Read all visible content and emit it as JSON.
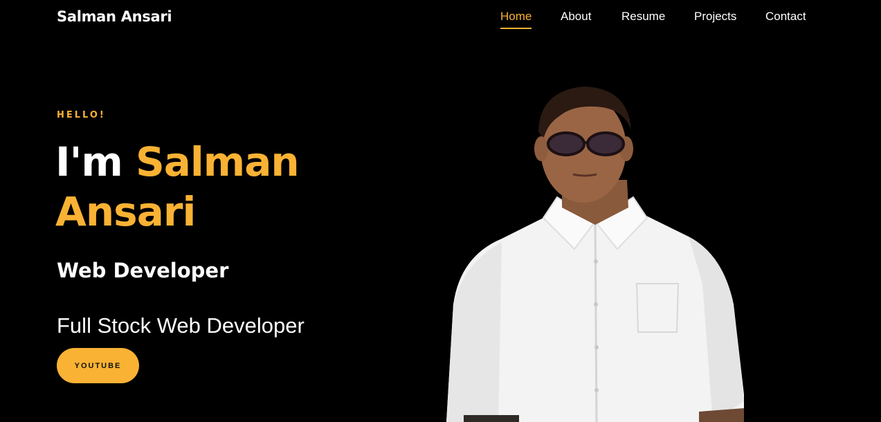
{
  "header": {
    "brand": "Salman Ansari",
    "nav": [
      {
        "label": "Home",
        "active": true
      },
      {
        "label": "About",
        "active": false
      },
      {
        "label": "Resume",
        "active": false
      },
      {
        "label": "Projects",
        "active": false
      },
      {
        "label": "Contact",
        "active": false
      }
    ]
  },
  "hero": {
    "greeting": "HELLO!",
    "headline_prefix": "I'm",
    "name_first": "Salman",
    "name_last": "Ansari",
    "role": "Web Developer",
    "tagline": "Full Stock Web Developer",
    "button_label": "YOUTUBE"
  },
  "colors": {
    "background": "#000000",
    "accent": "#f9b233",
    "text": "#ffffff",
    "shirt": "#f4f4f4"
  }
}
